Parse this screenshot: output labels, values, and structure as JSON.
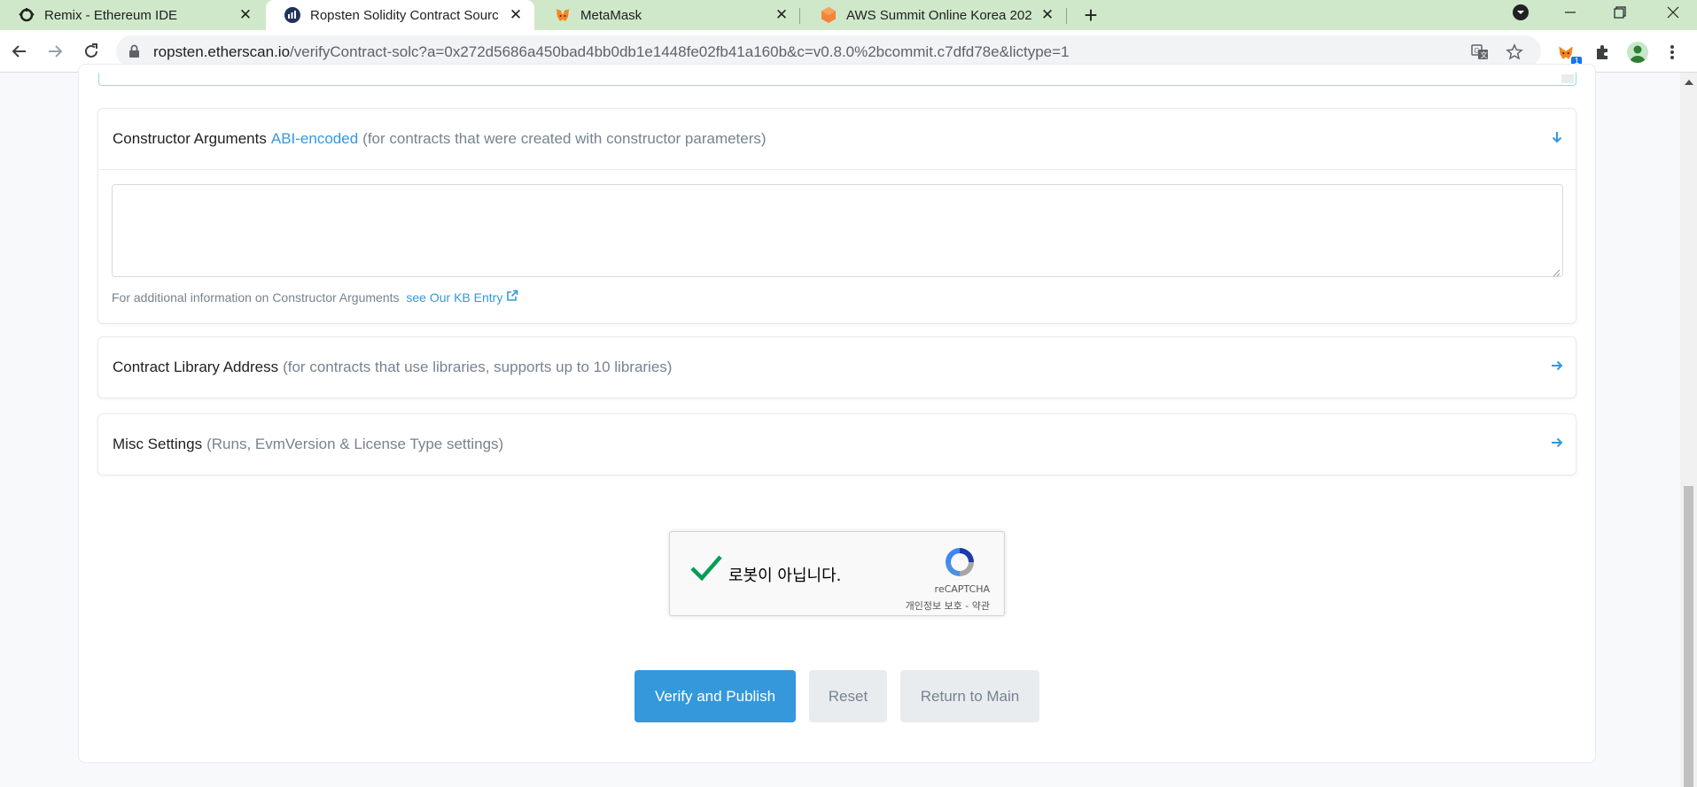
{
  "browser": {
    "tabs": [
      {
        "title": "Remix - Ethereum IDE",
        "icon": "remix-icon",
        "active": false
      },
      {
        "title": "Ropsten Solidity Contract Sourc",
        "icon": "etherscan-icon",
        "active": true
      },
      {
        "title": "MetaMask",
        "icon": "metamask-icon",
        "active": false
      },
      {
        "title": "AWS Summit Online Korea 202",
        "icon": "aws-icon",
        "active": false
      }
    ],
    "address": {
      "host": "ropsten.etherscan.io",
      "path": "/verifyContract-solc?a=0x272d5686a450bad4bb0db1e1448fe02fb41a160b&c=v0.8.0%2bcommit.c7dfd78e&lictype=1"
    },
    "extension_badge": "1"
  },
  "sections": {
    "constructor": {
      "title": "Constructor Arguments",
      "link": "ABI-encoded",
      "subtitle": "(for contracts that were created with constructor parameters)",
      "textarea_value": "",
      "note": "For additional information on Constructor Arguments",
      "note_link": "see Our KB Entry"
    },
    "library": {
      "title": "Contract Library Address",
      "subtitle": "(for contracts that use libraries, supports up to 10 libraries)"
    },
    "misc": {
      "title": "Misc Settings",
      "subtitle": "(Runs, EvmVersion & License Type settings)"
    }
  },
  "captcha": {
    "label": "로봇이 아닙니다.",
    "brand": "reCAPTCHA",
    "terms": "개인정보 보호 - 약관",
    "checked": true
  },
  "actions": {
    "verify": "Verify and Publish",
    "reset": "Reset",
    "return": "Return to Main"
  },
  "colors": {
    "tabstrip": "#cfe8c9",
    "link": "#3498db",
    "primary": "#3498db",
    "check": "#009e55"
  }
}
